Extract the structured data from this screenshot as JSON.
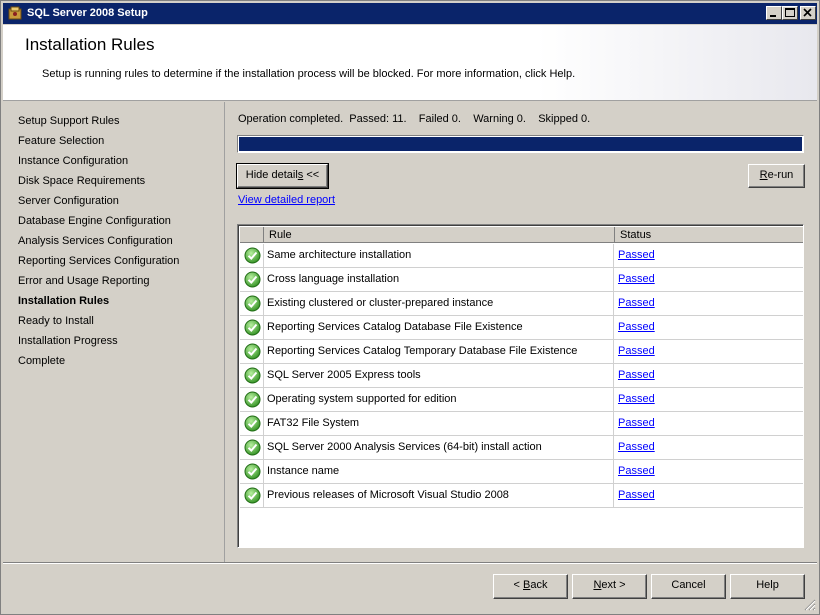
{
  "window": {
    "title": "SQL Server 2008 Setup"
  },
  "header": {
    "title": "Installation Rules",
    "description": "Setup is running rules to determine if the installation process will be blocked. For more information, click Help."
  },
  "sidebar": {
    "steps": [
      {
        "label": "Setup Support Rules",
        "active": false
      },
      {
        "label": "Feature Selection",
        "active": false
      },
      {
        "label": "Instance Configuration",
        "active": false
      },
      {
        "label": "Disk Space Requirements",
        "active": false
      },
      {
        "label": "Server Configuration",
        "active": false
      },
      {
        "label": "Database Engine Configuration",
        "active": false
      },
      {
        "label": "Analysis Services Configuration",
        "active": false
      },
      {
        "label": "Reporting Services Configuration",
        "active": false
      },
      {
        "label": "Error and Usage Reporting",
        "active": false
      },
      {
        "label": "Installation Rules",
        "active": true
      },
      {
        "label": "Ready to Install",
        "active": false
      },
      {
        "label": "Installation Progress",
        "active": false
      },
      {
        "label": "Complete",
        "active": false
      }
    ]
  },
  "main": {
    "status": "Operation completed.  Passed: 11.    Failed 0.    Warning 0.    Skipped 0.",
    "progress": 1.0,
    "hide_details_prefix": "Hide detail",
    "hide_details_ul": "s",
    "hide_details_suffix": " <<",
    "rerun_ul": "R",
    "rerun_rest": "e-run",
    "view_report": "View detailed report",
    "grid": {
      "col_rule": "Rule",
      "col_status": "Status",
      "rows": [
        {
          "rule": "Same architecture installation",
          "status": "Passed"
        },
        {
          "rule": "Cross language installation",
          "status": "Passed"
        },
        {
          "rule": "Existing clustered or cluster-prepared instance",
          "status": "Passed"
        },
        {
          "rule": "Reporting Services Catalog Database File Existence",
          "status": "Passed"
        },
        {
          "rule": "Reporting Services Catalog Temporary Database File Existence",
          "status": "Passed"
        },
        {
          "rule": "SQL Server 2005 Express tools",
          "status": "Passed"
        },
        {
          "rule": "Operating system supported for edition",
          "status": "Passed"
        },
        {
          "rule": "FAT32 File System",
          "status": "Passed"
        },
        {
          "rule": "SQL Server 2000 Analysis Services (64-bit) install action",
          "status": "Passed"
        },
        {
          "rule": "Instance name",
          "status": "Passed"
        },
        {
          "rule": "Previous releases of Microsoft Visual Studio 2008",
          "status": "Passed"
        }
      ]
    }
  },
  "footer": {
    "back_prefix": "< ",
    "back_ul": "B",
    "back_rest": "ack",
    "next_ul": "N",
    "next_rest": "ext >",
    "cancel": "Cancel",
    "help": "Help"
  },
  "icons": {
    "row_status": "check-circle-icon",
    "app": "sql-server-setup-icon"
  },
  "colors": {
    "titlebar": "#0a246a",
    "progress": "#0a246a",
    "check": "#3a9a2a",
    "link": "#0000ff"
  }
}
